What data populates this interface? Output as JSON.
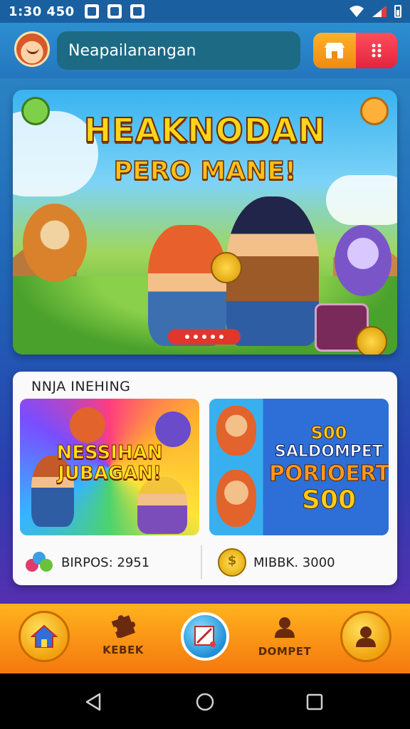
{
  "status_bar": {
    "time": "1:30 450"
  },
  "header": {
    "title": "Neapailanangan"
  },
  "banner": {
    "title": "HEAKNODAN",
    "subtitle": "PERO MANE!"
  },
  "section": {
    "heading": "NNJA INEHING"
  },
  "tiles": {
    "left_text_line1": "NESSIHAN",
    "left_text_line2": "JUBAGAN!",
    "right_line0": "S00",
    "right_line1": "SALDOMPET",
    "right_line2": "PORIOERT",
    "right_line3": "S00"
  },
  "stats": {
    "left_label": "BIRPOS: 2951",
    "right_label": "MIBBK. 3000"
  },
  "bottom_nav": {
    "item2_label": "KEBEK",
    "item4_label": "DOMPET"
  },
  "colors": {
    "status_bar": "#1a5fa0",
    "header_pill": "#1d6a85",
    "accent_orange": "#f08a10",
    "accent_red": "#e3243c",
    "nav_bar": "#f5780e"
  }
}
